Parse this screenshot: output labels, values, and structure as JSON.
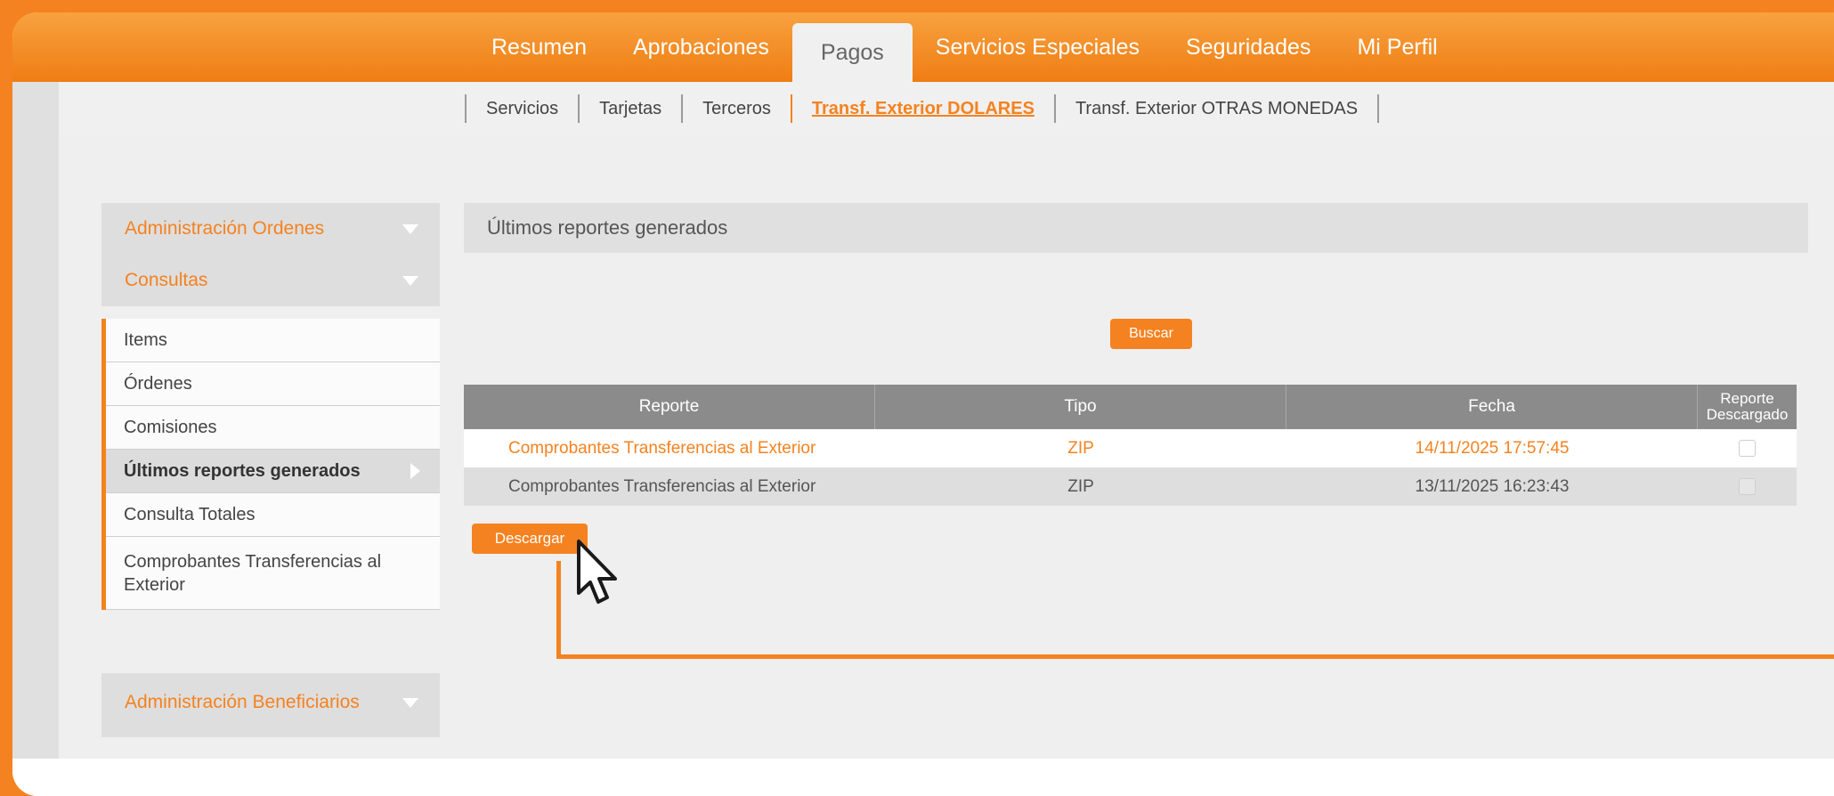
{
  "nav": {
    "tabs": [
      {
        "label": "Resumen"
      },
      {
        "label": "Aprobaciones"
      },
      {
        "label": "Pagos"
      },
      {
        "label": "Servicios Especiales"
      },
      {
        "label": "Seguridades"
      },
      {
        "label": "Mi Perfil"
      }
    ],
    "active_tab": "Pagos"
  },
  "subnav": {
    "items": [
      {
        "label": "Servicios"
      },
      {
        "label": "Tarjetas"
      },
      {
        "label": "Terceros"
      },
      {
        "label": "Transf. Exterior DOLARES"
      },
      {
        "label": "Transf. Exterior OTRAS MONEDAS"
      }
    ],
    "active_item": "Transf. Exterior DOLARES"
  },
  "sidebar": {
    "sections": [
      {
        "label": "Administración Ordenes"
      },
      {
        "label": "Consultas"
      },
      {
        "label": "Administración Beneficiarios"
      }
    ],
    "items": [
      {
        "label": "Items"
      },
      {
        "label": "Órdenes"
      },
      {
        "label": "Comisiones"
      },
      {
        "label": "Últimos reportes generados"
      },
      {
        "label": "Consulta Totales"
      },
      {
        "label": "Comprobantes Transferencias al Exterior"
      }
    ],
    "selected_item": "Últimos reportes generados"
  },
  "main": {
    "title": "Últimos reportes generados",
    "search_button": "Buscar",
    "download_button": "Descargar",
    "table": {
      "headers": [
        "Reporte",
        "Tipo",
        "Fecha",
        "Reporte Descargado"
      ],
      "rows": [
        {
          "reporte": "Comprobantes Transferencias al Exterior",
          "tipo": "ZIP",
          "fecha": "14/11/2025 17:57:45",
          "descargado": false
        },
        {
          "reporte": "Comprobantes Transferencias al Exterior",
          "tipo": "ZIP",
          "fecha": "13/11/2025 16:23:43",
          "descargado": false
        }
      ]
    }
  },
  "colors": {
    "accent": "#f58220",
    "header_gray": "#8b8b8b"
  },
  "icons": {
    "section_toggle": "triangle-down-icon",
    "selected_indicator": "triangle-right-icon",
    "cursor": "mouse-pointer-icon"
  }
}
